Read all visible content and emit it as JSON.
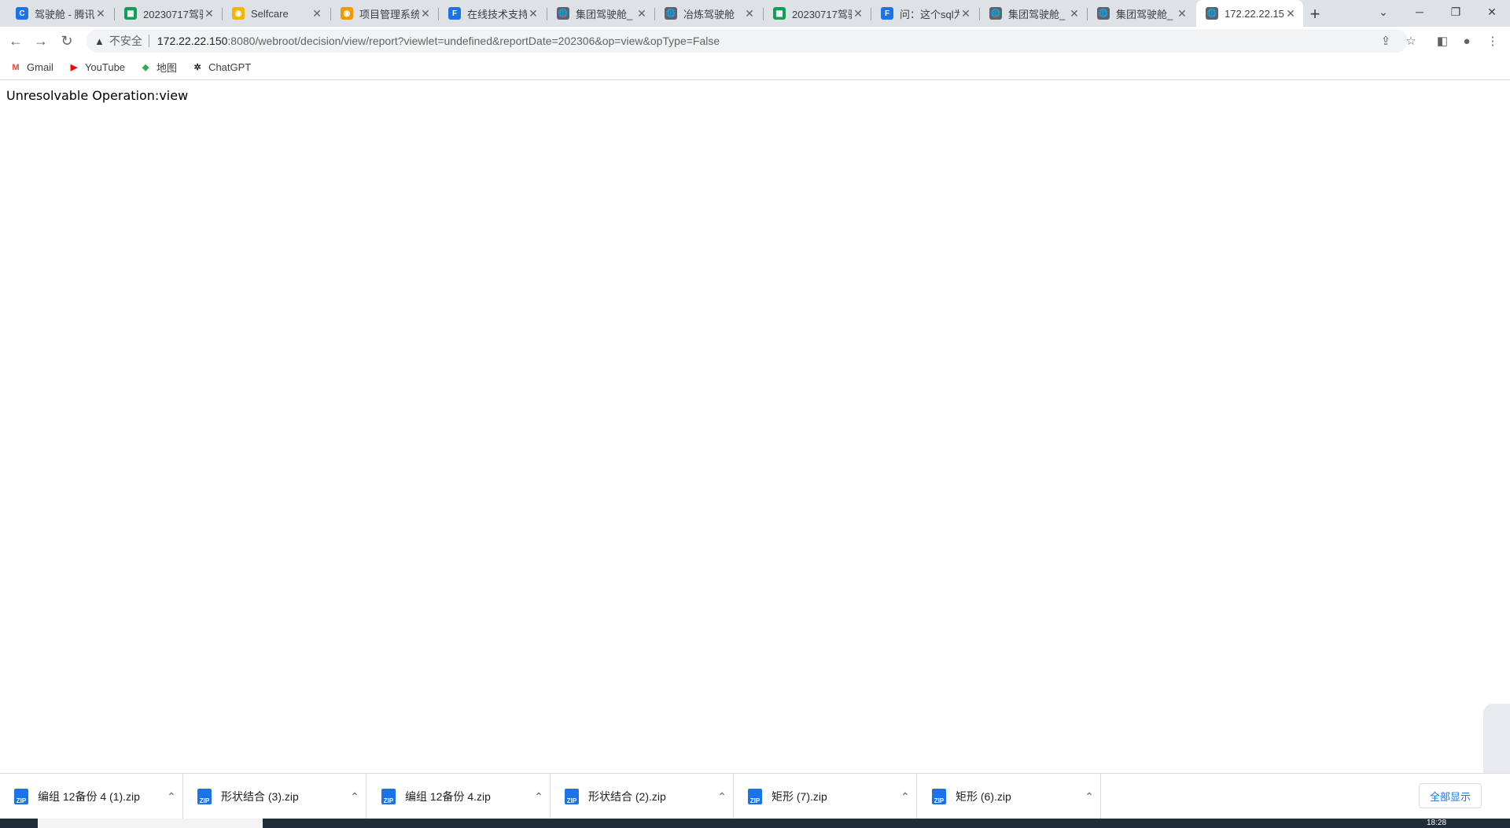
{
  "browser": {
    "tabs": [
      {
        "label": "驾驶舱 - 腾讯",
        "favicon": "tencent-docs-icon",
        "color": "#1a73e8",
        "glyph": "C"
      },
      {
        "label": "20230717驾驶",
        "favicon": "sheet-icon",
        "color": "#0f9d58",
        "glyph": "▦"
      },
      {
        "label": "Selfcare",
        "favicon": "selfcare-icon",
        "color": "#f4b400",
        "glyph": "◉"
      },
      {
        "label": "项目管理系统",
        "favicon": "project-icon",
        "color": "#f29900",
        "glyph": "◉"
      },
      {
        "label": "在线技术支持",
        "favicon": "finereport-icon",
        "color": "#1a73e8",
        "glyph": "F"
      },
      {
        "label": "集团驾驶舱_",
        "favicon": "globe-icon",
        "color": "#5f6368",
        "glyph": "🌐"
      },
      {
        "label": "冶炼驾驶舱",
        "favicon": "globe-icon",
        "color": "#5f6368",
        "glyph": "🌐"
      },
      {
        "label": "20230717驾驶",
        "favicon": "sheet-icon",
        "color": "#0f9d58",
        "glyph": "▦"
      },
      {
        "label": "问：这个sql为",
        "favicon": "finereport-icon",
        "color": "#1a73e8",
        "glyph": "F"
      },
      {
        "label": "集团驾驶舱_",
        "favicon": "globe-icon",
        "color": "#5f6368",
        "glyph": "🌐"
      },
      {
        "label": "集团驾驶舱_",
        "favicon": "globe-icon",
        "color": "#5f6368",
        "glyph": "🌐"
      },
      {
        "label": "172.22.22.15",
        "favicon": "globe-icon",
        "color": "#5f6368",
        "glyph": "🌐"
      }
    ],
    "active_tab_index": 11,
    "address": {
      "security_label": "不安全",
      "host": "172.22.22.150",
      "path": ":8080/webroot/decision/view/report?viewlet=undefined&reportDate=202306&op=view&opType=False"
    },
    "bookmarks": [
      {
        "label": "Gmail",
        "icon": "gmail-icon",
        "color": "#ea4335",
        "glyph": "M"
      },
      {
        "label": "YouTube",
        "icon": "youtube-icon",
        "color": "#ff0000",
        "glyph": "▶"
      },
      {
        "label": "地图",
        "icon": "maps-icon",
        "color": "#34a853",
        "glyph": "◆"
      },
      {
        "label": "ChatGPT",
        "icon": "chatgpt-icon",
        "color": "#202124",
        "glyph": "✲"
      }
    ]
  },
  "page": {
    "message": "Unresolvable Operation:view"
  },
  "downloads": {
    "items": [
      {
        "name": "编组 12备份 4 (1).zip"
      },
      {
        "name": "形状结合 (3).zip"
      },
      {
        "name": "编组 12备份 4.zip"
      },
      {
        "name": "形状结合 (2).zip"
      },
      {
        "name": "矩形 (7).zip"
      },
      {
        "name": "矩形 (6).zip"
      }
    ],
    "show_all_label": "全部显示",
    "zip_badge": "ZIP"
  },
  "taskbar": {
    "clock": "18:28"
  }
}
